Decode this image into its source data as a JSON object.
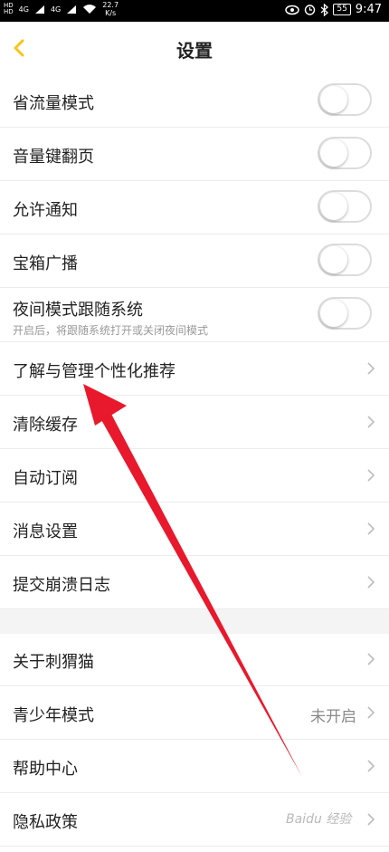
{
  "status_bar": {
    "hd1": "HD",
    "hd2": "HD",
    "net1": "4G",
    "net2": "4G",
    "speed_value": "22.7",
    "speed_unit": "K/s",
    "battery": "55",
    "time": "9:47"
  },
  "header": {
    "title": "设置"
  },
  "settings": {
    "data_saver": {
      "label": "省流量模式",
      "on": false
    },
    "volume_page_turn": {
      "label": "音量键翻页",
      "on": false
    },
    "allow_notifications": {
      "label": "允许通知",
      "on": false
    },
    "chest_broadcast": {
      "label": "宝箱广播",
      "on": false
    },
    "night_follow_system": {
      "label": "夜间模式跟随系统",
      "description": "开启后，将跟随系统打开或关闭夜间模式",
      "on": false
    },
    "personalized": {
      "label": "了解与管理个性化推荐"
    },
    "clear_cache": {
      "label": "清除缓存"
    },
    "auto_subscribe": {
      "label": "自动订阅"
    },
    "message_settings": {
      "label": "消息设置"
    },
    "crash_log": {
      "label": "提交崩溃日志"
    },
    "about": {
      "label": "关于刺猬猫"
    },
    "youth_mode": {
      "label": "青少年模式",
      "value": "未开启"
    },
    "help": {
      "label": "帮助中心"
    },
    "privacy": {
      "label": "隐私政策"
    }
  },
  "watermark": "Baidu 经验",
  "colors": {
    "accent": "#f5c518",
    "arrow": "#e8192c",
    "toggle_border": "#dcdcdc",
    "divider": "#ececec",
    "section_gap": "#f4f4f4"
  }
}
